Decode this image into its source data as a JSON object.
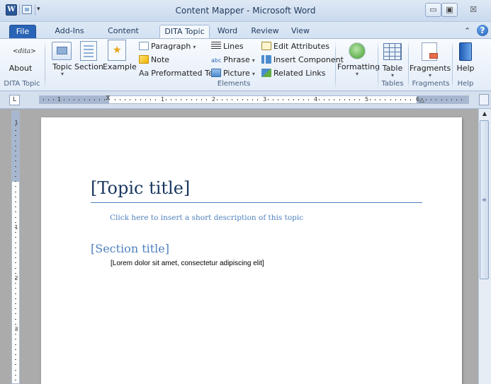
{
  "window": {
    "title": "Content Mapper - Microsoft Word",
    "app_icon_letter": "W",
    "close_glyph": "☒",
    "min_glyph": "▭",
    "max_glyph": "▣"
  },
  "tabs": [
    {
      "label": "File"
    },
    {
      "label": "Add-Ins"
    },
    {
      "label": "Content Mapper"
    },
    {
      "label": "DITA Topic"
    },
    {
      "label": "Word"
    },
    {
      "label": "Review"
    },
    {
      "label": "View"
    }
  ],
  "active_tab": "DITA Topic",
  "ribbon": {
    "about": {
      "label": "About",
      "icon_text": "<dita>"
    },
    "topic": {
      "label": "Topic"
    },
    "section": {
      "label": "Section"
    },
    "example": {
      "label": "Example"
    },
    "paragraph": {
      "label": "Paragraph"
    },
    "note": {
      "label": "Note"
    },
    "preformatted": {
      "label": "Preformatted Text",
      "icon_text": "Aa"
    },
    "lines": {
      "label": "Lines"
    },
    "phrase": {
      "label": "Phrase",
      "icon_text": "abc"
    },
    "picture": {
      "label": "Picture"
    },
    "edit_attributes": {
      "label": "Edit Attributes"
    },
    "insert_component": {
      "label": "Insert Component"
    },
    "related_links": {
      "label": "Related Links"
    },
    "formatting": {
      "label": "Formatting"
    },
    "table": {
      "label": "Table"
    },
    "fragments": {
      "label": "Fragments"
    },
    "help": {
      "label": "Help"
    },
    "groups": {
      "dita_topic": "DITA Topic",
      "elements": "Elements",
      "tables": "Tables",
      "fragments": "Fragments",
      "help": "Help"
    }
  },
  "ruler": {
    "numbers": [
      "1",
      "1",
      "2",
      "3",
      "4",
      "5",
      "6"
    ],
    "vertical_numbers": [
      "1",
      "1",
      "2",
      "3"
    ],
    "tab_selector": "L"
  },
  "document": {
    "topic_title": "[Topic title]",
    "short_description": "Click here to insert a short description of this topic",
    "section_title": "[Section title]",
    "body_text": "[Lorem dolor sit amet, consectetur adipiscing elit]"
  },
  "colors": {
    "file_tab": "#2a64b6",
    "heading_dark": "#17365d",
    "heading_accent": "#4f81bd"
  }
}
